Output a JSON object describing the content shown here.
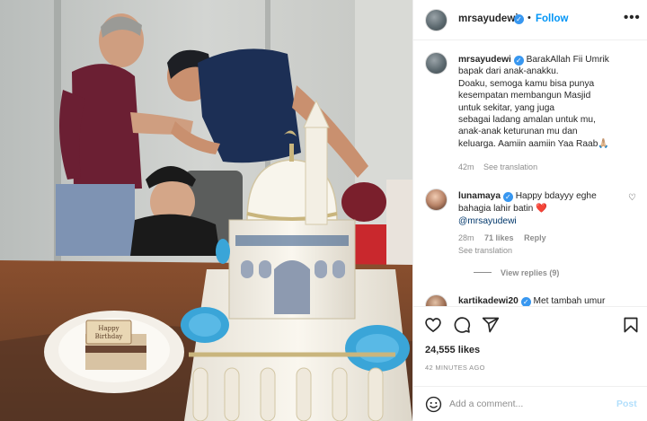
{
  "post": {
    "username": "mrsayudewi",
    "follow_label": "Follow",
    "more_label": "•••",
    "dot": "•"
  },
  "caption": {
    "username": "mrsayudewi",
    "lines": [
      "BarakAllah Fii Umrik",
      "bapak dari anak-anakku.",
      "Doaku, semoga kamu bisa punya",
      "kesempatan membangun Masjid",
      "untuk sekitar, yang juga",
      "sebagai ladang amalan untuk mu,",
      "anak-anak keturunan mu dan",
      "keluarga. Aamiin aamiin Yaa Raab"
    ],
    "emoji": "🙏🏼",
    "time": "42m",
    "see_translation": "See translation"
  },
  "comments": [
    {
      "username": "lunamaya",
      "text": "Happy bdayyy eghe bahagia lahir batin",
      "emoji": "❤️",
      "mention": "@mrsayudewi",
      "time": "28m",
      "likes": "71 likes",
      "reply": "Reply",
      "see_translation": "See translation",
      "view_replies": "View replies (9)",
      "like_icon": "heart-icon"
    },
    {
      "username": "kartikadewi20",
      "text": "Met tambah umur"
    }
  ],
  "actions": {
    "icons": [
      "heart-icon",
      "comment-icon",
      "share-icon",
      "bookmark-icon"
    ]
  },
  "likes_label": "24,555 likes",
  "timestamp": "42 MINUTES AGO",
  "add_comment": {
    "placeholder": "Add a comment...",
    "post_label": "Post"
  },
  "photo": {
    "cake_topper_lines": [
      "Happy",
      "Birthday"
    ]
  },
  "colors": {
    "accent": "#0095f6",
    "verified": "#3897f0",
    "heart": "#ed4956",
    "post_disabled": "#b2dffc"
  }
}
